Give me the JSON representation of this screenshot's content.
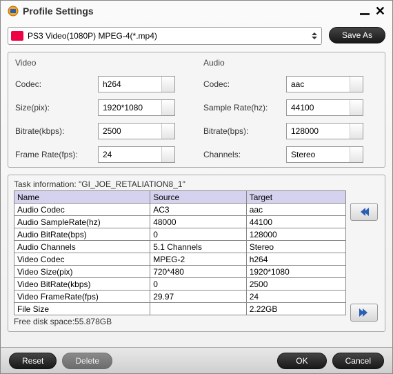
{
  "window": {
    "title": "Profile Settings"
  },
  "profile": {
    "selected": "PS3 Video(1080P) MPEG-4(*.mp4)",
    "save_as_label": "Save As"
  },
  "video": {
    "section": "Video",
    "labels": {
      "codec": "Codec:",
      "size": "Size(pix):",
      "bitrate": "Bitrate(kbps):",
      "framerate": "Frame Rate(fps):"
    },
    "values": {
      "codec": "h264",
      "size": "1920*1080",
      "bitrate": "2500",
      "framerate": "24"
    }
  },
  "audio": {
    "section": "Audio",
    "labels": {
      "codec": "Codec:",
      "samplerate": "Sample Rate(hz):",
      "bitrate": "Bitrate(bps):",
      "channels": "Channels:"
    },
    "values": {
      "codec": "aac",
      "samplerate": "44100",
      "bitrate": "128000",
      "channels": "Stereo"
    }
  },
  "task": {
    "title": "Task information: \"GI_JOE_RETALIATION8_1\"",
    "headers": {
      "name": "Name",
      "source": "Source",
      "target": "Target"
    },
    "rows": [
      {
        "name": "Audio Codec",
        "source": "AC3",
        "target": "aac"
      },
      {
        "name": "Audio SampleRate(hz)",
        "source": "48000",
        "target": "44100"
      },
      {
        "name": "Audio BitRate(bps)",
        "source": "0",
        "target": "128000"
      },
      {
        "name": "Audio Channels",
        "source": "5.1 Channels",
        "target": "Stereo"
      },
      {
        "name": "Video Codec",
        "source": "MPEG-2",
        "target": "h264"
      },
      {
        "name": "Video Size(pix)",
        "source": "720*480",
        "target": "1920*1080"
      },
      {
        "name": "Video BitRate(kbps)",
        "source": "0",
        "target": "2500"
      },
      {
        "name": "Video FrameRate(fps)",
        "source": "29.97",
        "target": "24"
      },
      {
        "name": "File Size",
        "source": "",
        "target": "2.22GB"
      }
    ],
    "free_space": "Free disk space:55.878GB"
  },
  "footer": {
    "reset": "Reset",
    "delete": "Delete",
    "ok": "OK",
    "cancel": "Cancel"
  }
}
